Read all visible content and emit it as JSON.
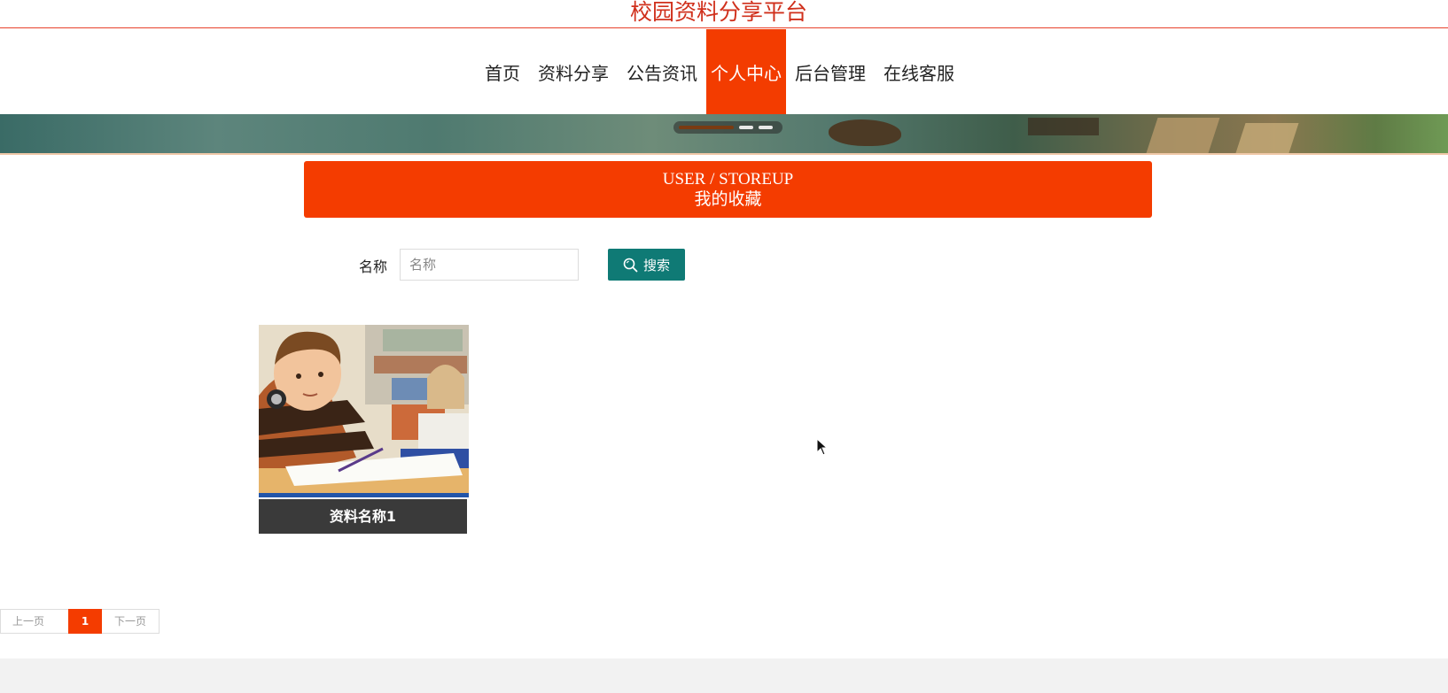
{
  "site": {
    "title": "校园资料分享平台"
  },
  "nav": {
    "items": [
      {
        "label": "首页"
      },
      {
        "label": "资料分享"
      },
      {
        "label": "公告资讯"
      },
      {
        "label": "个人中心"
      },
      {
        "label": "后台管理"
      },
      {
        "label": "在线客服"
      }
    ],
    "active": "个人中心"
  },
  "section": {
    "title_en": "USER / STOREUP",
    "title_cn": "我的收藏"
  },
  "search": {
    "label": "名称",
    "placeholder": "名称",
    "value": "",
    "button_label": "搜索",
    "button_icon": "search-icon"
  },
  "favorites": [
    {
      "name": "资料名称1",
      "image": "boy-in-classroom-photo"
    }
  ],
  "pagination": {
    "prev_label": "上一页",
    "current_page": "1",
    "next_label": "下一页"
  },
  "colors": {
    "accent": "#f43c00",
    "title_red": "#d0301c",
    "search_button": "#0f7a75",
    "card_caption": "#3a3a3a"
  }
}
